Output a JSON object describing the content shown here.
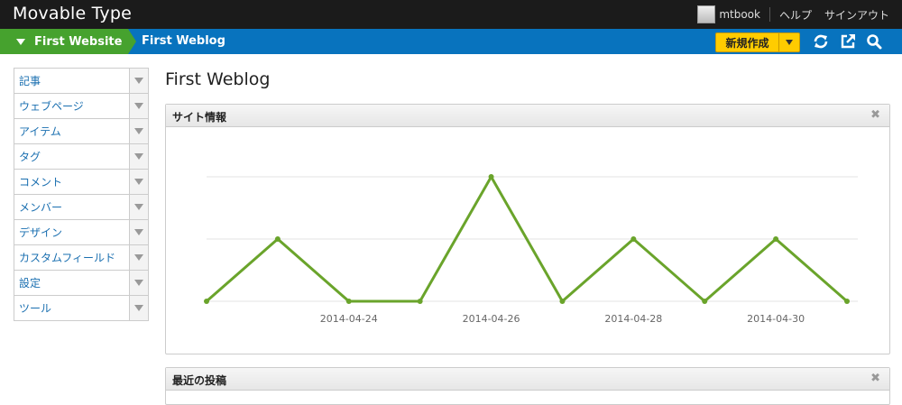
{
  "app": {
    "title": "Movable Type"
  },
  "user": {
    "name": "mtbook",
    "help": "ヘルプ",
    "signout": "サインアウト"
  },
  "breadcrumb": {
    "site": "First Website",
    "blog": "First Weblog"
  },
  "toolbar": {
    "new_label": "新規作成"
  },
  "icons": {
    "refresh": "refresh-icon",
    "view_site": "external-link-icon",
    "search": "search-icon"
  },
  "sidebar": {
    "items": [
      {
        "label": "記事"
      },
      {
        "label": "ウェブページ"
      },
      {
        "label": "アイテム"
      },
      {
        "label": "タグ"
      },
      {
        "label": "コメント"
      },
      {
        "label": "メンバー"
      },
      {
        "label": "デザイン"
      },
      {
        "label": "カスタムフィールド"
      },
      {
        "label": "設定"
      },
      {
        "label": "ツール"
      }
    ]
  },
  "page": {
    "title": "First Weblog"
  },
  "widgets": {
    "site_info": {
      "title": "サイト情報"
    },
    "recent_posts": {
      "title": "最近の投稿"
    }
  },
  "colors": {
    "accent_green": "#46a22e",
    "nav_blue": "#0873be",
    "button_yellow": "#ffcc00",
    "line_green": "#6aa42b"
  },
  "chart_data": {
    "type": "line",
    "x": [
      "2014-04-22",
      "2014-04-23",
      "2014-04-24",
      "2014-04-25",
      "2014-04-26",
      "2014-04-27",
      "2014-04-28",
      "2014-04-29",
      "2014-04-30",
      "2014-05-01"
    ],
    "x_tick_labels": [
      "2014-04-24",
      "2014-04-26",
      "2014-04-28",
      "2014-04-30"
    ],
    "series": [
      {
        "values": [
          0,
          1,
          0,
          0,
          2,
          0,
          1,
          0,
          1,
          0
        ]
      }
    ],
    "ylim": [
      0,
      2
    ],
    "grid": true,
    "title": "",
    "xlabel": "",
    "ylabel": ""
  }
}
